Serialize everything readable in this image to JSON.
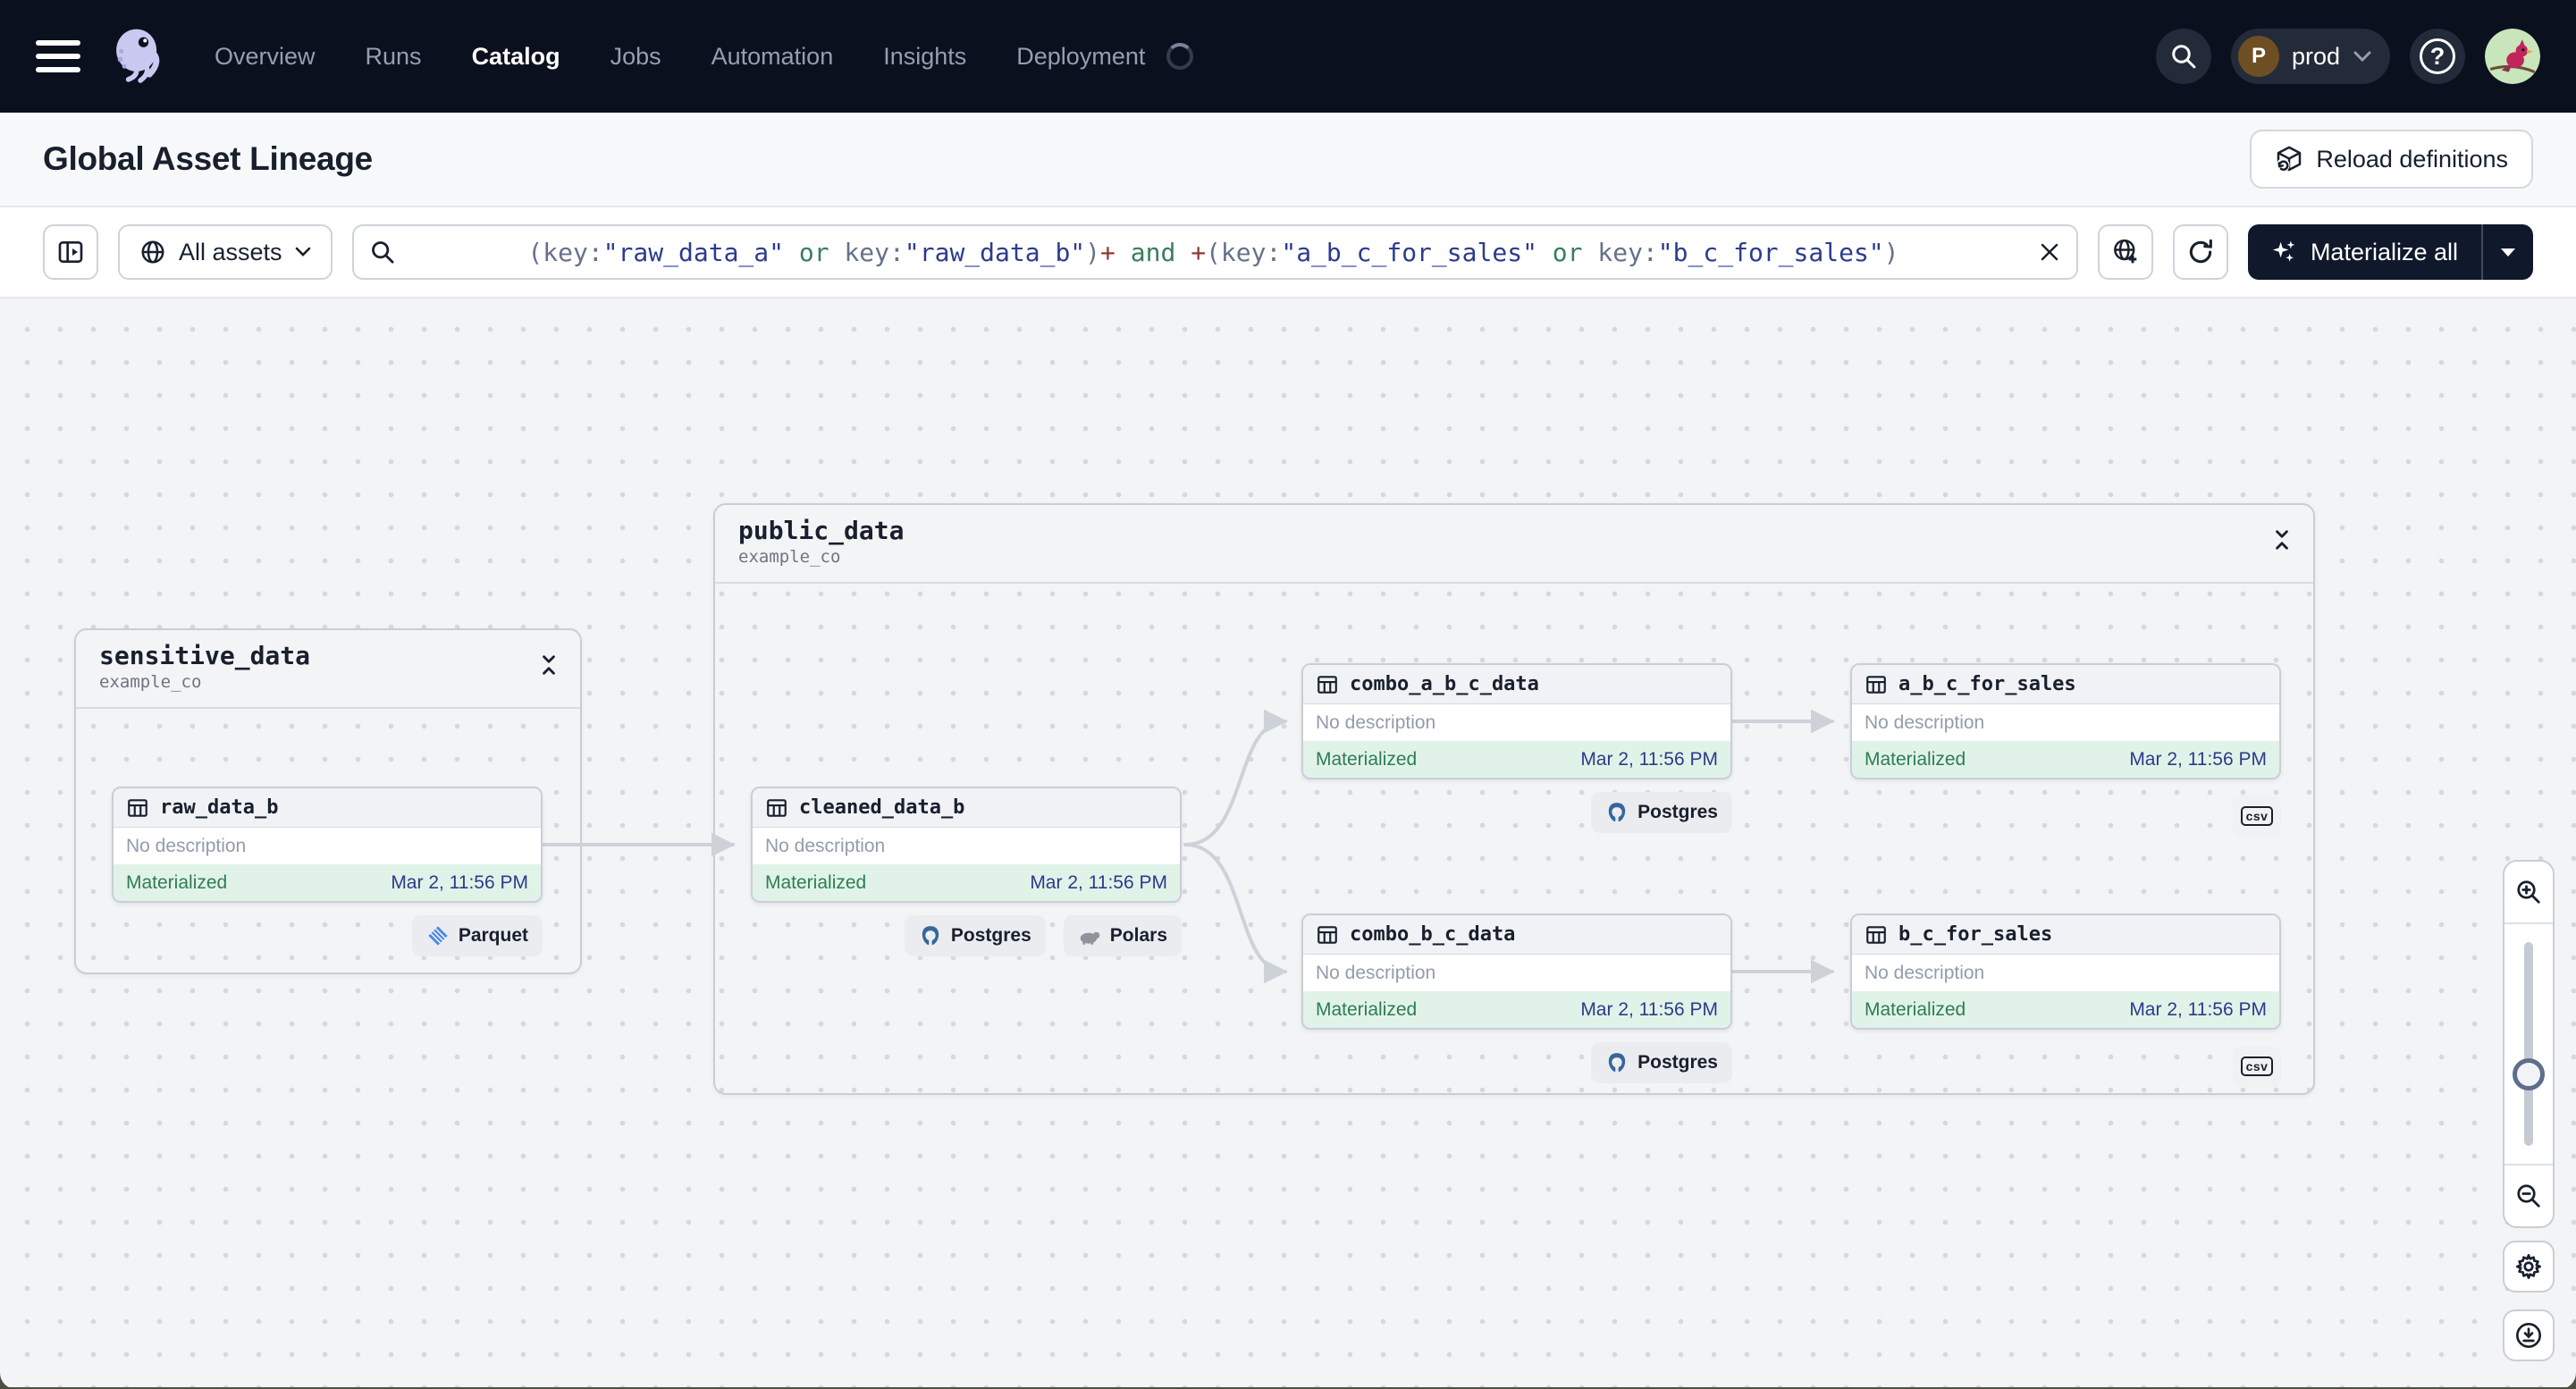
{
  "navbar": {
    "items": [
      {
        "label": "Overview"
      },
      {
        "label": "Runs"
      },
      {
        "label": "Catalog"
      },
      {
        "label": "Jobs"
      },
      {
        "label": "Automation"
      },
      {
        "label": "Insights"
      },
      {
        "label": "Deployment"
      }
    ],
    "active_item": "Catalog",
    "deployment": {
      "name": "prod",
      "avatar_letter": "P"
    }
  },
  "header": {
    "title": "Global Asset Lineage",
    "reload_label": "Reload definitions"
  },
  "toolbar": {
    "scope_label": "All assets",
    "materialize_label": "Materialize all",
    "query": {
      "full_text": "(key:\"raw_data_a\" or key:\"raw_data_b\")+ and +(key:\"a_b_c_for_sales\" or key:\"b_c_for_sales\")",
      "segments": [
        {
          "text": "(key:",
          "cls": "q-p"
        },
        {
          "text": "\"raw_data_a\"",
          "cls": "q-s"
        },
        {
          "text": " or ",
          "cls": "q-k"
        },
        {
          "text": "key:",
          "cls": "q-p"
        },
        {
          "text": "\"raw_data_b\"",
          "cls": "q-s"
        },
        {
          "text": ")",
          "cls": "q-p"
        },
        {
          "text": "+",
          "cls": "q-o"
        },
        {
          "text": " and ",
          "cls": "q-k"
        },
        {
          "text": "+",
          "cls": "q-o"
        },
        {
          "text": "(key:",
          "cls": "q-p"
        },
        {
          "text": "\"a_b_c_for_sales\"",
          "cls": "q-s"
        },
        {
          "text": " or ",
          "cls": "q-k"
        },
        {
          "text": "key:",
          "cls": "q-p"
        },
        {
          "text": "\"b_c_for_sales\"",
          "cls": "q-s"
        },
        {
          "text": ")",
          "cls": "q-p"
        }
      ]
    }
  },
  "graph": {
    "groups": [
      {
        "name": "sensitive_data",
        "repo": "example_co"
      },
      {
        "name": "public_data",
        "repo": "example_co"
      }
    ],
    "nodes": [
      {
        "name": "raw_data_b",
        "description": "No description",
        "status": "Materialized",
        "timestamp": "Mar 2, 11:56 PM"
      },
      {
        "name": "cleaned_data_b",
        "description": "No description",
        "status": "Materialized",
        "timestamp": "Mar 2, 11:56 PM"
      },
      {
        "name": "combo_a_b_c_data",
        "description": "No description",
        "status": "Materialized",
        "timestamp": "Mar 2, 11:56 PM"
      },
      {
        "name": "a_b_c_for_sales",
        "description": "No description",
        "status": "Materialized",
        "timestamp": "Mar 2, 11:56 PM"
      },
      {
        "name": "combo_b_c_data",
        "description": "No description",
        "status": "Materialized",
        "timestamp": "Mar 2, 11:56 PM"
      },
      {
        "name": "b_c_for_sales",
        "description": "No description",
        "status": "Materialized",
        "timestamp": "Mar 2, 11:56 PM"
      }
    ],
    "badges": {
      "parquet": "Parquet",
      "postgres": "Postgres",
      "polars": "Polars",
      "csv": "csv"
    }
  },
  "icons": {
    "navbar": [
      "menu-icon",
      "dagster-octopus-logo",
      "loading-spinner",
      "search-icon",
      "chevron-down-icon",
      "help-icon",
      "user-avatar"
    ],
    "toolbar": [
      "panel-expand-icon",
      "globe-icon",
      "search-icon",
      "clear-x-icon",
      "globe-add-icon",
      "refresh-icon",
      "sparkles-icon",
      "caret-down-icon"
    ],
    "graph": [
      "table-asset-icon",
      "collapse-vertical-icon",
      "parquet-diamond-icon",
      "postgres-elephant-icon",
      "polars-bear-icon",
      "csv-file-icon"
    ],
    "controls": [
      "zoom-in-icon",
      "zoom-out-icon",
      "gear-icon",
      "download-icon"
    ]
  },
  "colors": {
    "navbar_bg": "#0B101E",
    "materialized_green": "#2E7D54",
    "materialized_bg": "#E1F3E8",
    "timestamp_navy": "#2D3A8C",
    "edge_gray": "#CDD2D9",
    "accent_dark_button": "#10192B"
  }
}
